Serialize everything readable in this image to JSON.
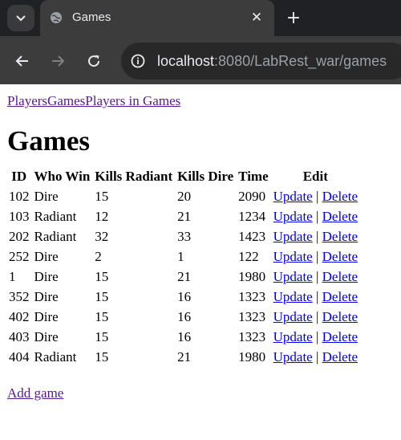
{
  "browser": {
    "tab_title": "Games",
    "url_host": "localhost",
    "url_rest": ":8080/LabRest_war/games"
  },
  "nav": {
    "players": "Players",
    "games": "Games",
    "players_in_games": "Players in Games"
  },
  "page_title": "Games",
  "table": {
    "headers": [
      "ID",
      "Who Win",
      "Kills Radiant",
      "Kills Dire",
      "Time",
      "Edit"
    ],
    "update_label": "Update",
    "separator": "|",
    "delete_label": "Delete",
    "rows": [
      {
        "id": "102",
        "who_win": "Dire",
        "kills_radiant": "15",
        "kills_dire": "20",
        "time": "2090"
      },
      {
        "id": "103",
        "who_win": "Radiant",
        "kills_radiant": "12",
        "kills_dire": "21",
        "time": "1234"
      },
      {
        "id": "202",
        "who_win": "Radiant",
        "kills_radiant": "32",
        "kills_dire": "33",
        "time": "1423"
      },
      {
        "id": "252",
        "who_win": "Dire",
        "kills_radiant": "2",
        "kills_dire": "1",
        "time": "122"
      },
      {
        "id": "1",
        "who_win": "Dire",
        "kills_radiant": "15",
        "kills_dire": "21",
        "time": "1980"
      },
      {
        "id": "352",
        "who_win": "Dire",
        "kills_radiant": "15",
        "kills_dire": "16",
        "time": "1323"
      },
      {
        "id": "402",
        "who_win": "Dire",
        "kills_radiant": "15",
        "kills_dire": "16",
        "time": "1323"
      },
      {
        "id": "403",
        "who_win": "Dire",
        "kills_radiant": "15",
        "kills_dire": "16",
        "time": "1323"
      },
      {
        "id": "404",
        "who_win": "Radiant",
        "kills_radiant": "15",
        "kills_dire": "21",
        "time": "1980"
      }
    ]
  },
  "add_game_label": "Add game",
  "icons": {
    "tab_menu": "chevron-down-icon",
    "favicon": "globe-icon",
    "tab_close": "close-icon",
    "new_tab": "plus-icon",
    "back": "arrow-left-icon",
    "forward": "arrow-right-icon",
    "reload": "reload-icon",
    "site_info": "info-icon"
  }
}
